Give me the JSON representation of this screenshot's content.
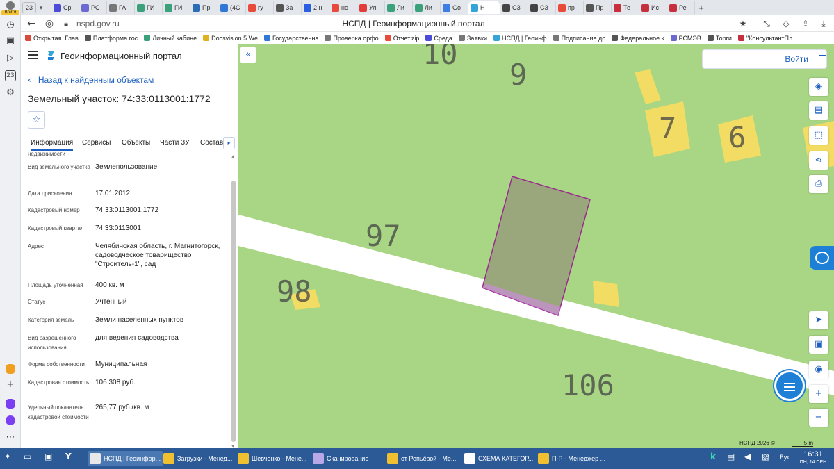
{
  "browser": {
    "tab_count": "23",
    "tabs": [
      {
        "label": "Ср",
        "color": "#4b4bd8"
      },
      {
        "label": "РС",
        "color": "#6a6ad0"
      },
      {
        "label": "ГА",
        "color": "#777777"
      },
      {
        "label": "ГИ",
        "color": "#3aa17a"
      },
      {
        "label": "ГИ",
        "color": "#3aa17a"
      },
      {
        "label": "Пр",
        "color": "#2a6fb5"
      },
      {
        "label": "(4С",
        "color": "#3077d6"
      },
      {
        "label": "гу",
        "color": "#e84b3c"
      },
      {
        "label": "За",
        "color": "#555555"
      },
      {
        "label": "2 н",
        "color": "#2b5de0"
      },
      {
        "label": "нс",
        "color": "#e84b3c"
      },
      {
        "label": "Ул",
        "color": "#e23b3b"
      },
      {
        "label": "Ли",
        "color": "#3aa17a"
      },
      {
        "label": "Ли",
        "color": "#3aa17a"
      },
      {
        "label": "Go",
        "color": "#3c7ee6"
      },
      {
        "label": "Н",
        "color": "#35a4d8"
      },
      {
        "label": "СЗ",
        "color": "#444444"
      },
      {
        "label": "СЗ",
        "color": "#444444"
      },
      {
        "label": "пр",
        "color": "#e84b3c"
      },
      {
        "label": "Пр",
        "color": "#555555"
      },
      {
        "label": "Те",
        "color": "#c62f3d"
      },
      {
        "label": "Ис",
        "color": "#c62f3d"
      },
      {
        "label": "Ре",
        "color": "#c62f3d"
      }
    ],
    "login_label": "Войти",
    "url": "nspd.gov.ru",
    "page_title": "НСПД | Геоинформационный портал",
    "bookmarks": [
      {
        "label": "Открытая. Глав",
        "color": "#d94a3b"
      },
      {
        "label": "Платформа гос",
        "color": "#555555"
      },
      {
        "label": "Личный кабине",
        "color": "#3aa17a"
      },
      {
        "label": "Docsvision 5 We",
        "color": "#e0b020"
      },
      {
        "label": "Государственна",
        "color": "#3077d6"
      },
      {
        "label": "Проверка орфо",
        "color": "#777777"
      },
      {
        "label": "Отчет.zip",
        "color": "#e84b3c"
      },
      {
        "label": "Среда",
        "color": "#4b4bd8"
      },
      {
        "label": "Заявки",
        "color": "#777777"
      },
      {
        "label": "НСПД | Геоинф",
        "color": "#35a4d8"
      },
      {
        "label": "Подписание до",
        "color": "#777777"
      },
      {
        "label": "Федеральное к",
        "color": "#555555"
      },
      {
        "label": "РСМЭВ",
        "color": "#6a6ad0"
      },
      {
        "label": "Торги",
        "color": "#555555"
      },
      {
        "label": "\"КонсультантПл",
        "color": "#c62f3d"
      }
    ]
  },
  "panel": {
    "title": "Геоинформационный портал",
    "back_label": "Назад к найденным объектам",
    "object_title": "Земельный участок: 74:33:0113001:1772",
    "tabs": [
      "Информация",
      "Сервисы",
      "Объекты",
      "Части ЗУ",
      "Состав"
    ],
    "partial_label": "недвижимости",
    "rows": [
      {
        "label": "Вид земельного участка",
        "value": "Землепользование"
      },
      {
        "label": "Дата присвоения",
        "value": "17.01.2012"
      },
      {
        "label": "Кадастровый номер",
        "value": "74:33:0113001:1772"
      },
      {
        "label": "Кадастровый квартал",
        "value": "74:33:0113001"
      },
      {
        "label": "Адрес",
        "value": "Челябинская область, г. Магнитогорск, садоводческое товарищество \"Строитель-1\", сад"
      },
      {
        "label": "Площадь уточненная",
        "value": "400 кв. м"
      },
      {
        "label": "Статус",
        "value": "Учтенный"
      },
      {
        "label": "Категория земель",
        "value": "Земли населенных пунктов"
      },
      {
        "label": "Вид разрешенного использования",
        "value": "для ведения садоводства"
      },
      {
        "label": "Форма собственности",
        "value": "Муниципальная"
      },
      {
        "label": "Кадастровая стоимость",
        "value": "106 308 руб."
      },
      {
        "label": "Удельный показатель кадастровой стоимости",
        "value": "265,77 руб./кв. м"
      }
    ]
  },
  "map": {
    "login_label": "Войти",
    "labels": [
      "10",
      "9",
      "7",
      "6",
      "97",
      "98",
      "106"
    ],
    "copyright": "НСПД 2026 ©",
    "scale": "5 m",
    "colors": {
      "land": "#a9d685",
      "road": "#ffffff",
      "parcel_fill": "#9aa67c",
      "parcel_border": "#9b2a8f",
      "building": "#f2dc63"
    }
  },
  "taskbar": {
    "items": [
      {
        "label": "НСПД | Геоинфор...",
        "color": "#e8e8e8"
      },
      {
        "label": "Загрузки - Менед...",
        "color": "#f0c030"
      },
      {
        "label": "Шевченко - Мене...",
        "color": "#f0c030"
      },
      {
        "label": "Сканирование",
        "color": "#b8a8e8"
      },
      {
        "label": "от Репьёвой - Ме...",
        "color": "#f0c030"
      },
      {
        "label": "СХЕМА КАТЕГОР...",
        "color": "#ffffff"
      },
      {
        "label": "П-Р - Менеджер ...",
        "color": "#f0c030"
      }
    ],
    "lang": "Рус",
    "time": "16:31",
    "date": "ПН, 14 СЕН"
  }
}
